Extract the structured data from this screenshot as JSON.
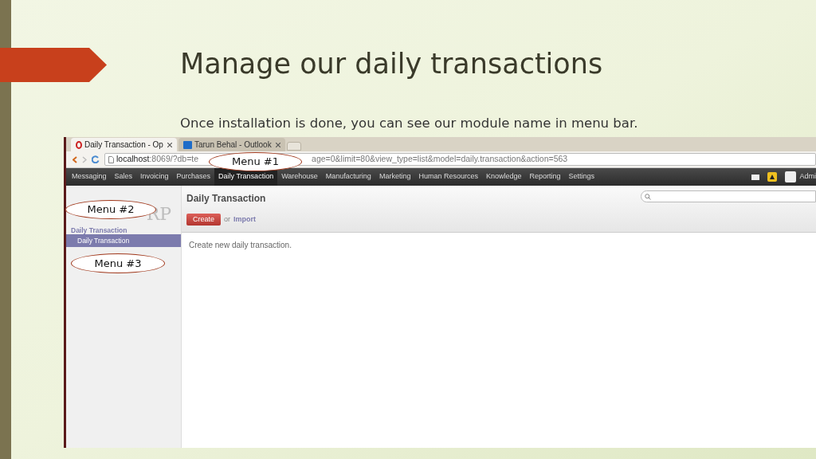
{
  "slide": {
    "title": "Manage our daily transactions",
    "subtitle": "Once installation is done, you can see our module name in menu bar."
  },
  "browser": {
    "tabs": [
      {
        "label": "Daily Transaction - Op",
        "selected": true,
        "kind": "opera"
      },
      {
        "label": "Tarun Behal - Outlook",
        "selected": false,
        "kind": "outlook"
      }
    ],
    "url_host": "localhost",
    "url_start": ":8069/?db=te",
    "url_end": "age=0&limit=80&view_type=list&model=daily.transaction&action=563"
  },
  "menu": [
    {
      "label": "Messaging",
      "selected": false
    },
    {
      "label": "Sales",
      "selected": false
    },
    {
      "label": "Invoicing",
      "selected": false
    },
    {
      "label": "Purchases",
      "selected": false
    },
    {
      "label": "Daily Transaction",
      "selected": true
    },
    {
      "label": "Warehouse",
      "selected": false
    },
    {
      "label": "Manufacturing",
      "selected": false
    },
    {
      "label": "Marketing",
      "selected": false
    },
    {
      "label": "Human Resources",
      "selected": false
    },
    {
      "label": "Knowledge",
      "selected": false
    },
    {
      "label": "Reporting",
      "selected": false
    },
    {
      "label": "Settings",
      "selected": false
    }
  ],
  "user": "Admi",
  "sidebar": {
    "logo": "RP",
    "heading": "Daily Transaction",
    "items": [
      {
        "label": "Daily Transaction",
        "selected": true
      }
    ]
  },
  "main": {
    "title": "Daily Transaction",
    "create": "Create",
    "or": "or",
    "import": "Import",
    "empty": "Create new daily transaction."
  },
  "callouts": [
    "Menu #1",
    "Menu #2",
    "Menu #3"
  ]
}
